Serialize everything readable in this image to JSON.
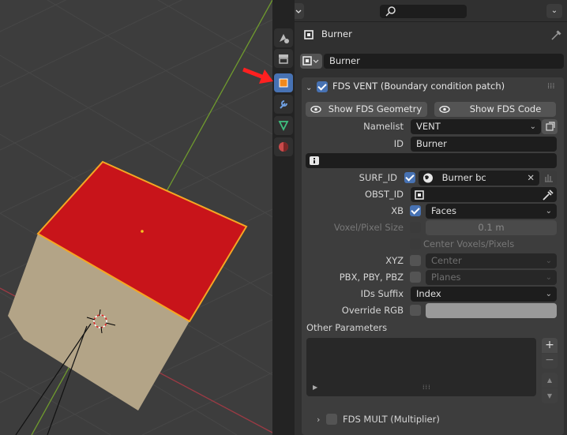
{
  "panel": {
    "object_name": "Burner",
    "material_name": "Burner",
    "section_title": "FDS VENT (Boundary condition patch)",
    "show_geometry_label": "Show FDS Geometry",
    "show_code_label": "Show FDS Code",
    "namelist_label": "Namelist",
    "namelist_value": "VENT",
    "id_label": "ID",
    "id_value": "Burner",
    "surf_id_label": "SURF_ID",
    "surf_id_value": "Burner bc",
    "obst_id_label": "OBST_ID",
    "xb_label": "XB",
    "xb_value": "Faces",
    "voxel_label": "Voxel/Pixel Size",
    "voxel_value": "0.1 m",
    "center_voxels_label": "Center Voxels/Pixels",
    "xyz_label": "XYZ",
    "xyz_value": "Center",
    "pbx_label": "PBX, PBY, PBZ",
    "pbx_value": "Planes",
    "ids_suffix_label": "IDs Suffix",
    "ids_suffix_value": "Index",
    "override_rgb_label": "Override RGB",
    "other_params_label": "Other Parameters",
    "mult_title": "FDS MULT (Multiplier)"
  },
  "icons": [
    "editor-type-icon",
    "search-icon",
    "tool-tab-icon",
    "render-tab-icon",
    "object-tab-icon",
    "modifier-tab-icon",
    "data-tab-icon",
    "material-tab-icon",
    "pin-icon",
    "eye-icon",
    "info-icon",
    "globe-icon",
    "eyedropper-icon"
  ],
  "colors": {
    "accent": "#4772b3",
    "annotation_arrow": "#ff2020",
    "object_top": "#c8141a",
    "object_side": "#b3a487",
    "selection_outline": "#f5a623"
  }
}
